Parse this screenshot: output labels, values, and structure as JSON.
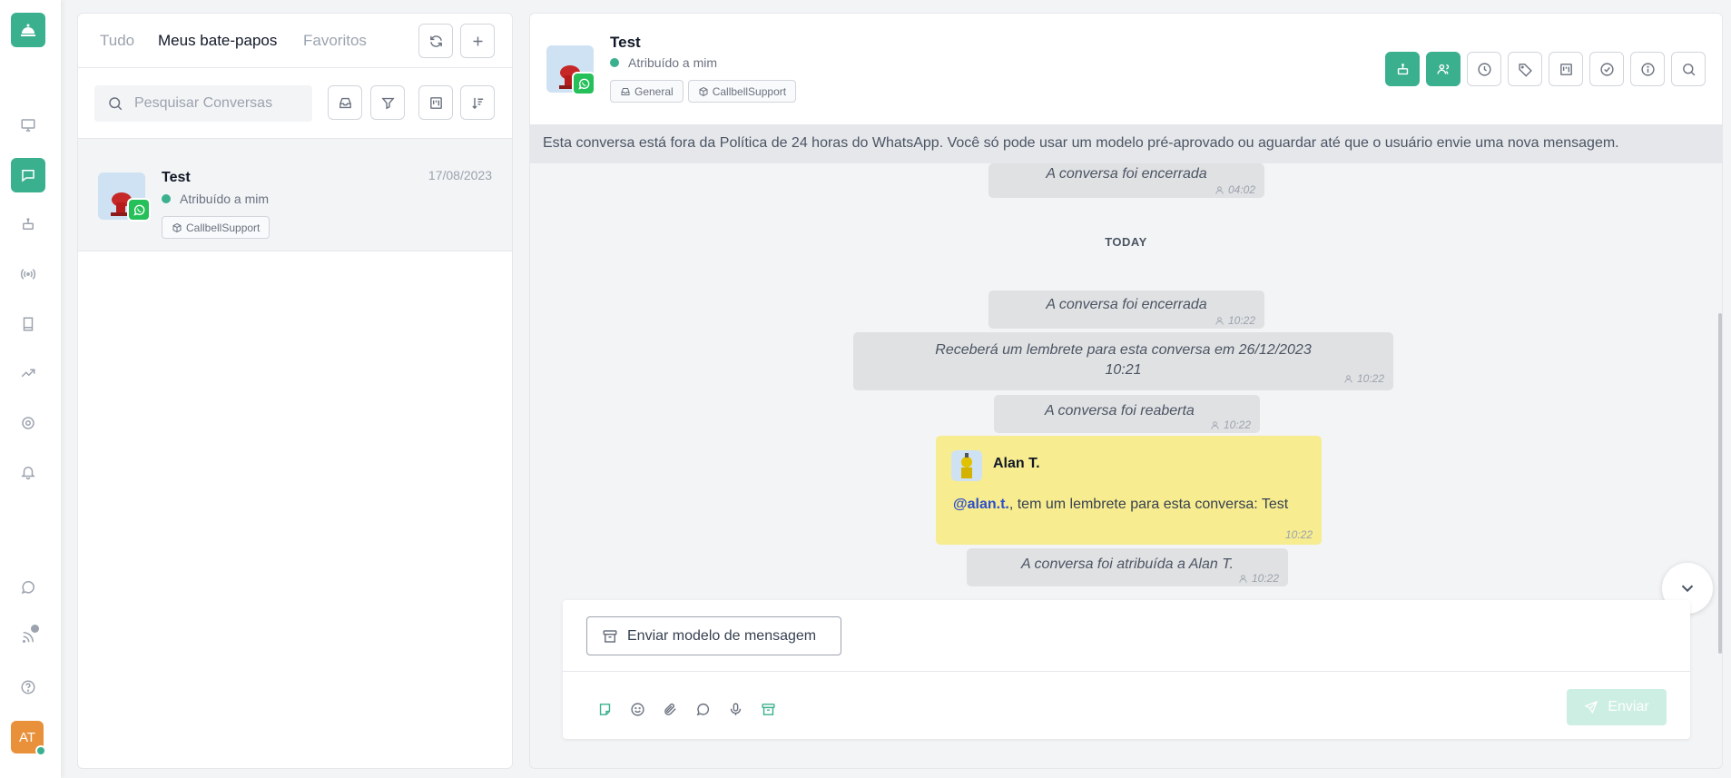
{
  "nav": {
    "items": [
      {
        "id": "logo",
        "icon": "bell-service-icon"
      },
      {
        "id": "dashboard",
        "icon": "monitor-icon"
      },
      {
        "id": "chats",
        "icon": "chat-icon",
        "active": true
      },
      {
        "id": "bots",
        "icon": "robot-icon"
      },
      {
        "id": "broadcast",
        "icon": "broadcast-icon"
      },
      {
        "id": "contacts",
        "icon": "book-icon"
      },
      {
        "id": "reports",
        "icon": "trending-up-icon"
      },
      {
        "id": "settings",
        "icon": "gear-icon"
      },
      {
        "id": "notifications",
        "icon": "bell-icon"
      },
      {
        "id": "whatsapp",
        "icon": "whatsapp-icon"
      },
      {
        "id": "feed",
        "icon": "rss-icon"
      },
      {
        "id": "help",
        "icon": "help-circle-icon"
      }
    ],
    "user_initials": "AT"
  },
  "list": {
    "tabs": [
      "Tudo",
      "Meus bate-papos",
      "Favoritos"
    ],
    "active_tab": "Meus bate-papos",
    "search_placeholder": "Pesquisar Conversas",
    "conversations": [
      {
        "name": "Test",
        "date": "17/08/2023",
        "status": "Atribuído a mim",
        "tags": [
          "CallbellSupport"
        ],
        "channel": "whatsapp"
      }
    ]
  },
  "chat": {
    "name": "Test",
    "status": "Atribuído a mim",
    "tags": [
      "General",
      "CallbellSupport"
    ],
    "policy_notice": "Esta conversa está fora da Política de 24 horas do WhatsApp. Você só pode usar um modelo pré-aprovado ou aguardar até que o usuário envie uma nova mensagem.",
    "messages": {
      "closed_1": {
        "text": "A conversa foi encerrada",
        "time": "04:02"
      },
      "day_separator": "TODAY",
      "closed_2": {
        "text": "A conversa foi encerrada",
        "time": "10:22"
      },
      "reminder_line1": "Receberá um lembrete para esta conversa em 26/12/2023",
      "reminder_line2": "10:21",
      "reminder_time": "10:22",
      "reopened": {
        "text": "A conversa foi reaberta",
        "time": "10:22"
      },
      "note": {
        "author": "Alan T.",
        "mention": "@alan.t.",
        "text": ", tem um lembrete para esta conversa: Test",
        "time": "10:22"
      },
      "assigned": {
        "text": "A conversa foi atribuída a Alan T.",
        "time": "10:22"
      }
    },
    "composer": {
      "template_button": "Enviar modelo de mensagem",
      "send_button": "Enviar"
    }
  },
  "colors": {
    "accent": "#3bb08f",
    "whatsapp": "#25c05a",
    "note_bg": "#f7ec8f",
    "mention": "#2f4fc9",
    "avatar_me": "#e8913a"
  }
}
